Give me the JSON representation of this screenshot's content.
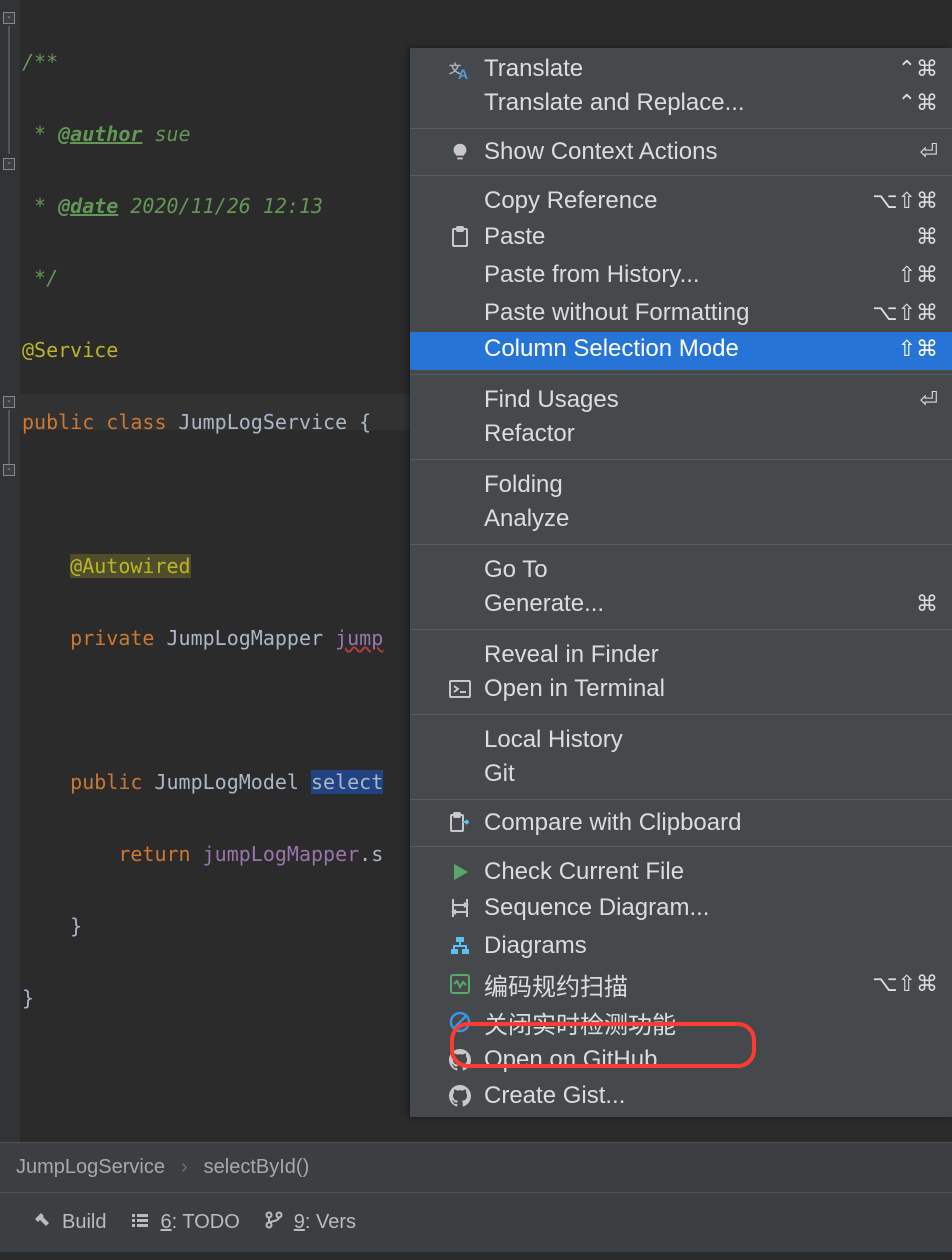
{
  "code": {
    "doc_open": "/**",
    "doc_author_tag": "@author",
    "doc_author_val": " sue",
    "doc_date_tag": "@date",
    "doc_date_val": " 2020/11/26 12:13",
    "doc_close": " */",
    "anno_service": "@Service",
    "kw_public": "public",
    "kw_class": "class",
    "cls_name": " JumpLogService {",
    "anno_autowired": "@Autowired",
    "kw_private": "private",
    "type_mapper": " JumpLogMapper ",
    "field_mapper": "jump",
    "kw_public2": "public",
    "type_model": " JumpLogModel ",
    "method_sel": "select",
    "kw_return": "return",
    "field_use": "jumpLogMapper",
    "member_suffix": ".s",
    "brace_close1": "    }",
    "brace_close2": "}"
  },
  "breadcrumbs": {
    "item1": "JumpLogService",
    "item2": "selectById()"
  },
  "bottombar": {
    "build": "Build",
    "todo_prefix": "6",
    "todo_rest": ": TODO",
    "vcs_prefix": "9",
    "vcs_rest": ": Vers"
  },
  "menu": {
    "translate": "Translate",
    "translate_sc": "⌃⌘",
    "translate_replace": "Translate and Replace...",
    "translate_replace_sc": "⌃⌘",
    "show_actions": "Show Context Actions",
    "show_actions_sc": "⏎",
    "copy_ref": "Copy Reference",
    "copy_ref_sc": "⌥⇧⌘",
    "paste": "Paste",
    "paste_sc": "⌘",
    "paste_hist": "Paste from History...",
    "paste_hist_sc": "⇧⌘",
    "paste_nofmt": "Paste without Formatting",
    "paste_nofmt_sc": "⌥⇧⌘",
    "col_sel": "Column Selection Mode",
    "col_sel_sc": "⇧⌘",
    "find_usages": "Find Usages",
    "find_usages_sc": "⏎",
    "refactor": "Refactor",
    "folding": "Folding",
    "analyze": "Analyze",
    "goto": "Go To",
    "generate": "Generate...",
    "generate_sc": "⌘",
    "reveal": "Reveal in Finder",
    "open_terminal": "Open in Terminal",
    "local_history": "Local History",
    "git": "Git",
    "compare_clip": "Compare with Clipboard",
    "check_file": "Check Current File",
    "seq_diagram": "Sequence Diagram...",
    "diagrams": "Diagrams",
    "code_scan": "编码规约扫描",
    "code_scan_sc": "⌥⇧⌘",
    "disable_rt": "关闭实时检测功能",
    "open_github": "Open on GitHub",
    "create_gist": "Create Gist..."
  }
}
